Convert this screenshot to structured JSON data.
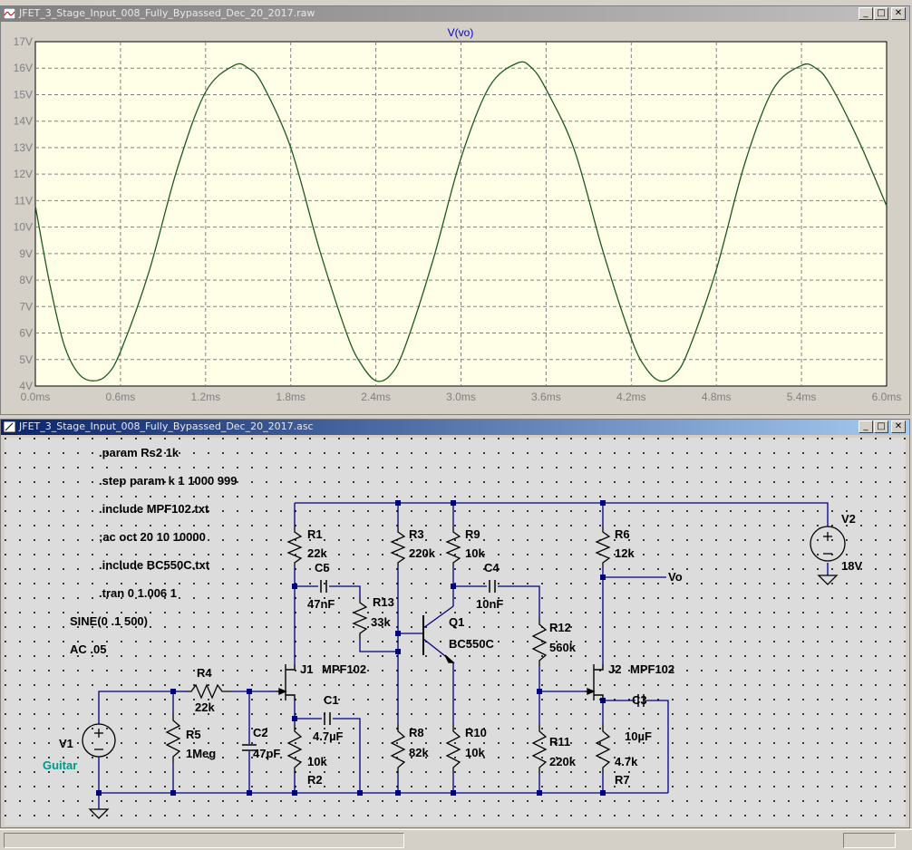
{
  "waveform_window": {
    "title": "JFET_3_Stage_Input_008_Fully_Bypassed_Dec_20_2017.raw",
    "trace_label": "V(vo)",
    "y_ticks": [
      "17V",
      "16V",
      "15V",
      "14V",
      "13V",
      "12V",
      "11V",
      "10V",
      "9V",
      "8V",
      "7V",
      "6V",
      "5V",
      "4V"
    ],
    "x_ticks": [
      "0.0ms",
      "0.6ms",
      "1.2ms",
      "1.8ms",
      "2.4ms",
      "3.0ms",
      "3.6ms",
      "4.2ms",
      "4.8ms",
      "5.4ms",
      "6.0ms"
    ],
    "trace_color": "#1e5a1e"
  },
  "chart_data": {
    "type": "line",
    "title": "V(vo)",
    "xlabel": "",
    "ylabel": "",
    "xlim": [
      0.0,
      6.0
    ],
    "ylim": [
      4,
      17
    ],
    "x_unit": "ms",
    "y_unit": "V",
    "grid": true,
    "series": [
      {
        "name": "V(vo)",
        "x": [
          0.0,
          0.1,
          0.2,
          0.3,
          0.4,
          0.5,
          0.6,
          0.8,
          1.0,
          1.2,
          1.4,
          1.5,
          1.6,
          1.8,
          2.0,
          2.2,
          2.3,
          2.4,
          2.5,
          2.6,
          2.8,
          3.0,
          3.2,
          3.4,
          3.5,
          3.6,
          3.8,
          4.0,
          4.2,
          4.3,
          4.4,
          4.5,
          4.6,
          4.8,
          5.0,
          5.2,
          5.4,
          5.5,
          5.6,
          5.8,
          6.0
        ],
        "y": [
          10.8,
          7.9,
          5.6,
          4.5,
          4.2,
          4.4,
          5.3,
          8.3,
          12.2,
          15.1,
          16.1,
          16.0,
          15.4,
          13.0,
          9.2,
          5.9,
          4.8,
          4.2,
          4.4,
          5.4,
          8.7,
          12.6,
          15.3,
          16.2,
          16.0,
          15.2,
          12.9,
          9.1,
          5.8,
          4.7,
          4.2,
          4.4,
          5.3,
          8.4,
          12.4,
          15.2,
          16.1,
          16.0,
          15.4,
          13.3,
          10.8
        ]
      }
    ]
  },
  "schematic_window": {
    "title": "JFET_3_Stage_Input_008_Fully_Bypassed_Dec_20_2017.asc",
    "directives": [
      ".param Rs2 1k",
      ".step param k 1 1000 999",
      ".include MPF102.txt",
      ";ac oct 20 10 10000",
      ".include BC550C.txt",
      ".tran 0 1.006 1",
      "SINE(0 .1 500)",
      "AC .05"
    ],
    "labels": {
      "R1": "R1",
      "R1v": "22k",
      "R2": "R2",
      "R2v": "10k",
      "R3": "R3",
      "R3v": "220k",
      "R4": "R4",
      "R4v": "22k",
      "R5": "R5",
      "R5v": "1Meg",
      "R6": "R6",
      "R6v": "12k",
      "R7": "R7",
      "R7v": "4.7k",
      "R8": "R8",
      "R8v": "82k",
      "R9": "R9",
      "R9v": "10k",
      "R10": "R10",
      "R10v": "10k",
      "R11": "R11",
      "R11v": "220k",
      "R12": "R12",
      "R12v": "560k",
      "R13": "R13",
      "R13v": "33k",
      "C1": "C1",
      "C1v": "4.7µF",
      "C2": "C2",
      "C2v": "47pF",
      "C3": "C3",
      "C3v": "10µF",
      "C4": "C4",
      "C4v": "10nF",
      "C5": "C5",
      "C5v": "47nF",
      "J1": "J1",
      "J1m": "MPF102",
      "J2": "J2",
      "J2m": "MPF102",
      "Q1": "Q1",
      "Q1m": "BC550C",
      "V1": "V1",
      "V1n": "Guitar",
      "V2": "V2",
      "V2v": "18V",
      "Vo": "Vo"
    },
    "wire_color": "#000080",
    "component_color": "#000000",
    "guitar_color": "#009688"
  },
  "title_buttons": {
    "minimize": "_",
    "maximize": "□",
    "close": "✕"
  }
}
